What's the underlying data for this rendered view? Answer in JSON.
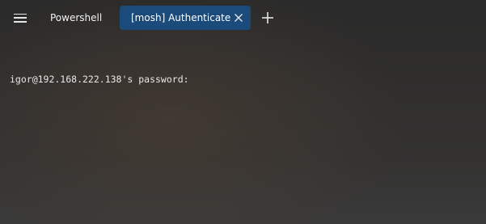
{
  "tabs": [
    {
      "label": "Powershell",
      "active": false
    },
    {
      "label": "[mosh] Authenticate",
      "active": true
    }
  ],
  "icons": {
    "menu": "hamburger-menu-icon",
    "close": "close-icon",
    "new_tab": "plus-icon"
  },
  "colors": {
    "active_tab": "#1b4b7a",
    "background": "#2c2c2c",
    "text": "#e8e8e8"
  },
  "terminal": {
    "lines": [
      "igor@192.168.222.138's password:"
    ]
  }
}
